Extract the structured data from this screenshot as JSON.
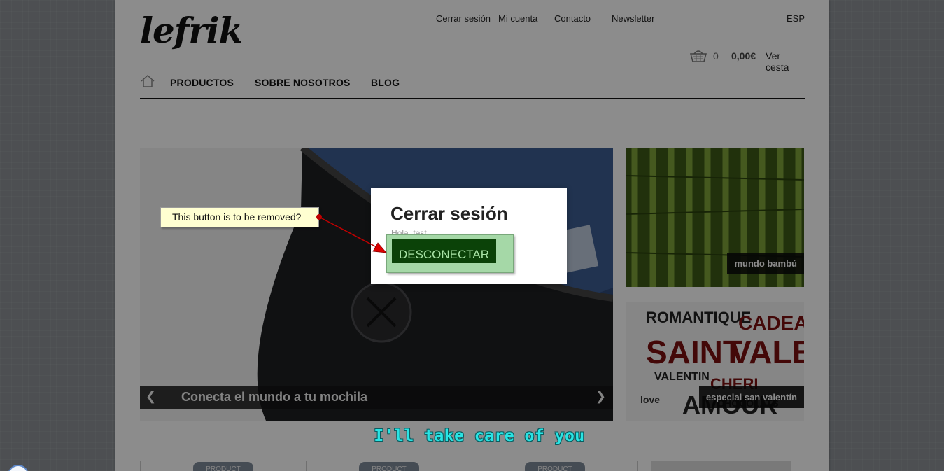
{
  "header": {
    "logo": "lefrik",
    "top_links": [
      "Cerrar sesión",
      "Mi cuenta",
      "Contacto",
      "Newsletter"
    ],
    "language": "ESP",
    "cart": {
      "icon": "basket-icon",
      "count": "0",
      "total": "0,00€",
      "view_label": "Ver cesta"
    }
  },
  "nav": {
    "home_icon": "home-icon",
    "items": [
      "PRODUCTOS",
      "SOBRE NOSOTROS",
      "BLOG"
    ]
  },
  "slider": {
    "caption": "Conecta el mundo a tu mochila",
    "prev": "❮",
    "next": "❯"
  },
  "promos": [
    {
      "label": "mundo bambú"
    },
    {
      "label": "especial san valentín"
    }
  ],
  "products": {
    "tags": [
      "PRODUCT",
      "PRODUCT",
      "PRODUCT"
    ]
  },
  "modal": {
    "title": "Cerrar sesión",
    "greeting": "Hola, test",
    "button_label": "DESCONECTAR"
  },
  "annotation": {
    "note_text": "This button is to be removed?"
  },
  "video_subtitle": "I'll take care of you",
  "colors": {
    "button_bg": "#0b4208",
    "button_text": "#a9e3a6",
    "highlight": "#a5d8a7",
    "note_bg": "#ffffd1",
    "subtitle": "#29e4e4"
  }
}
